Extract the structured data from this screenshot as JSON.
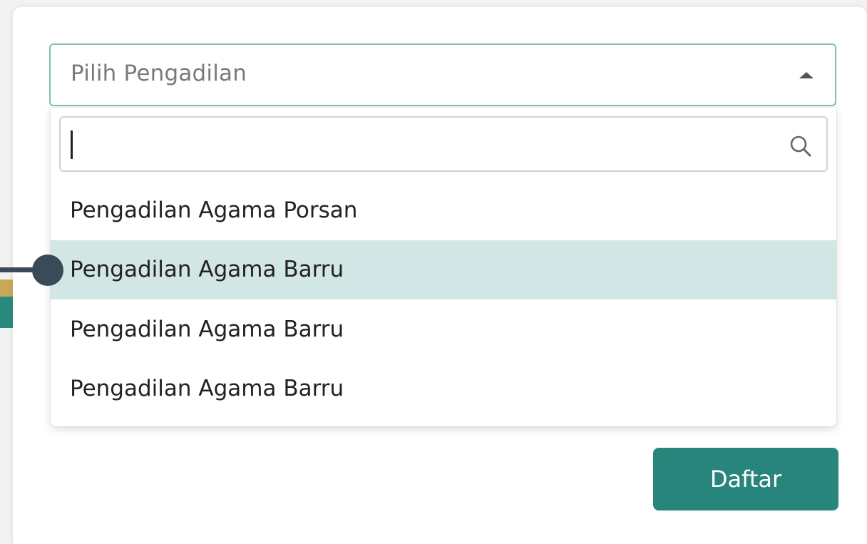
{
  "select": {
    "placeholder": "Pilih Pengadilan",
    "expanded": true
  },
  "dropdown": {
    "search": {
      "value": "",
      "icon": "search-icon"
    },
    "options": [
      {
        "label": "Pengadilan Agama Porsan",
        "highlighted": false
      },
      {
        "label": "Pengadilan Agama Barru",
        "highlighted": true
      },
      {
        "label": "Pengadilan Agama Barru",
        "highlighted": false
      },
      {
        "label": "Pengadilan Agama Barru",
        "highlighted": false
      }
    ]
  },
  "actions": {
    "submit_label": "Daftar"
  },
  "colors": {
    "accent": "#28857c",
    "select_border": "#7fbdb6",
    "highlight": "#d2e6e5",
    "pointer": "#3a4a59"
  }
}
